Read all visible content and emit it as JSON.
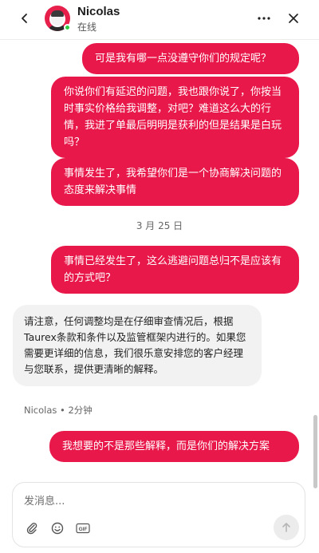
{
  "header": {
    "contact_name": "Nicolas",
    "status": "在线"
  },
  "messages": [
    {
      "direction": "out",
      "text": "可是我有哪一点没遵守你们的规定呢？"
    },
    {
      "direction": "out",
      "text": "你说你们有延迟的问题，我也跟你说了，你按当时事实价格给我调整，对吧？难道这么大的行情，我进了单最后明明是获利的但是结果是白玩吗？"
    },
    {
      "direction": "out",
      "text": "事情发生了，我希望你们是一个协商解决问题的态度来解决事情"
    },
    {
      "date_separator": "3 月 25 日"
    },
    {
      "direction": "out",
      "text": "事情已经发生了，这么逃避问题总归不是应该有的方式吧？"
    },
    {
      "direction": "in",
      "text": "请注意，任何调整均是在仔细审查情况后，根据Taurex条款和条件以及监管框架内进行的。如果您需要更详细的信息，我们很乐意安排您的客户经理与您联系，提供更清晰的解释。"
    },
    {
      "sender_meta": "Nicolas • 2分钟"
    },
    {
      "direction": "out",
      "text": "我想要的不是那些解释，而是你们的解决方案"
    }
  ],
  "composer": {
    "placeholder": "发消息..."
  },
  "icons": {
    "back": "chevron-left-icon",
    "more": "more-horizontal-icon",
    "close": "close-icon",
    "attach": "paperclip-icon",
    "emoji": "smiley-icon",
    "gif": "gif-icon",
    "send": "arrow-up-icon"
  },
  "colors": {
    "outgoing_bubble": "#e8184a",
    "incoming_bubble": "#f2f2f2",
    "avatar_bg": "#e61f4b",
    "online": "#2ecc40"
  }
}
